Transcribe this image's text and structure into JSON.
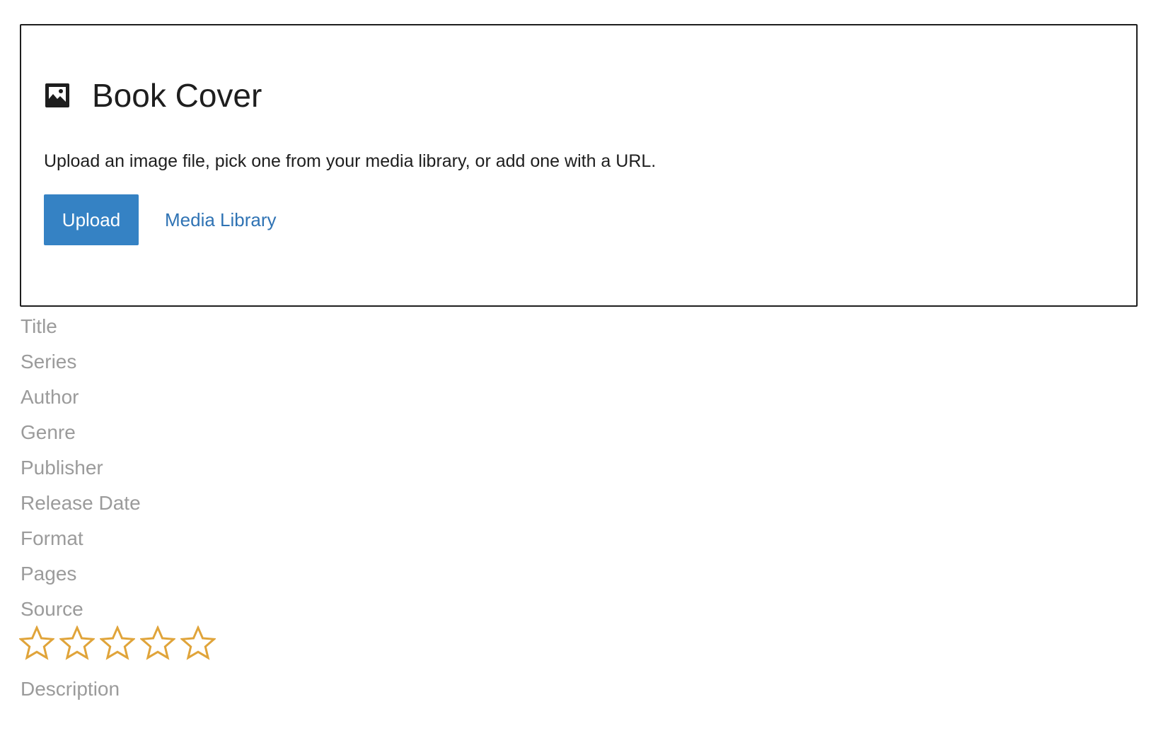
{
  "cover": {
    "icon": "image-icon",
    "title": "Book Cover",
    "instructions": "Upload an image file, pick one from your media library, or add one with a URL.",
    "upload_label": "Upload",
    "media_library_label": "Media Library",
    "button_color": "#3582c4",
    "link_color": "#2f73b4"
  },
  "fields": {
    "title": "Title",
    "series": "Series",
    "author": "Author",
    "genre": "Genre",
    "publisher": "Publisher",
    "release_date": "Release Date",
    "format": "Format",
    "pages": "Pages",
    "source": "Source"
  },
  "rating": {
    "value": 0,
    "max": 5,
    "icon": "star-outline-icon",
    "color": "#e0a43a"
  },
  "description": {
    "label": "Description"
  }
}
